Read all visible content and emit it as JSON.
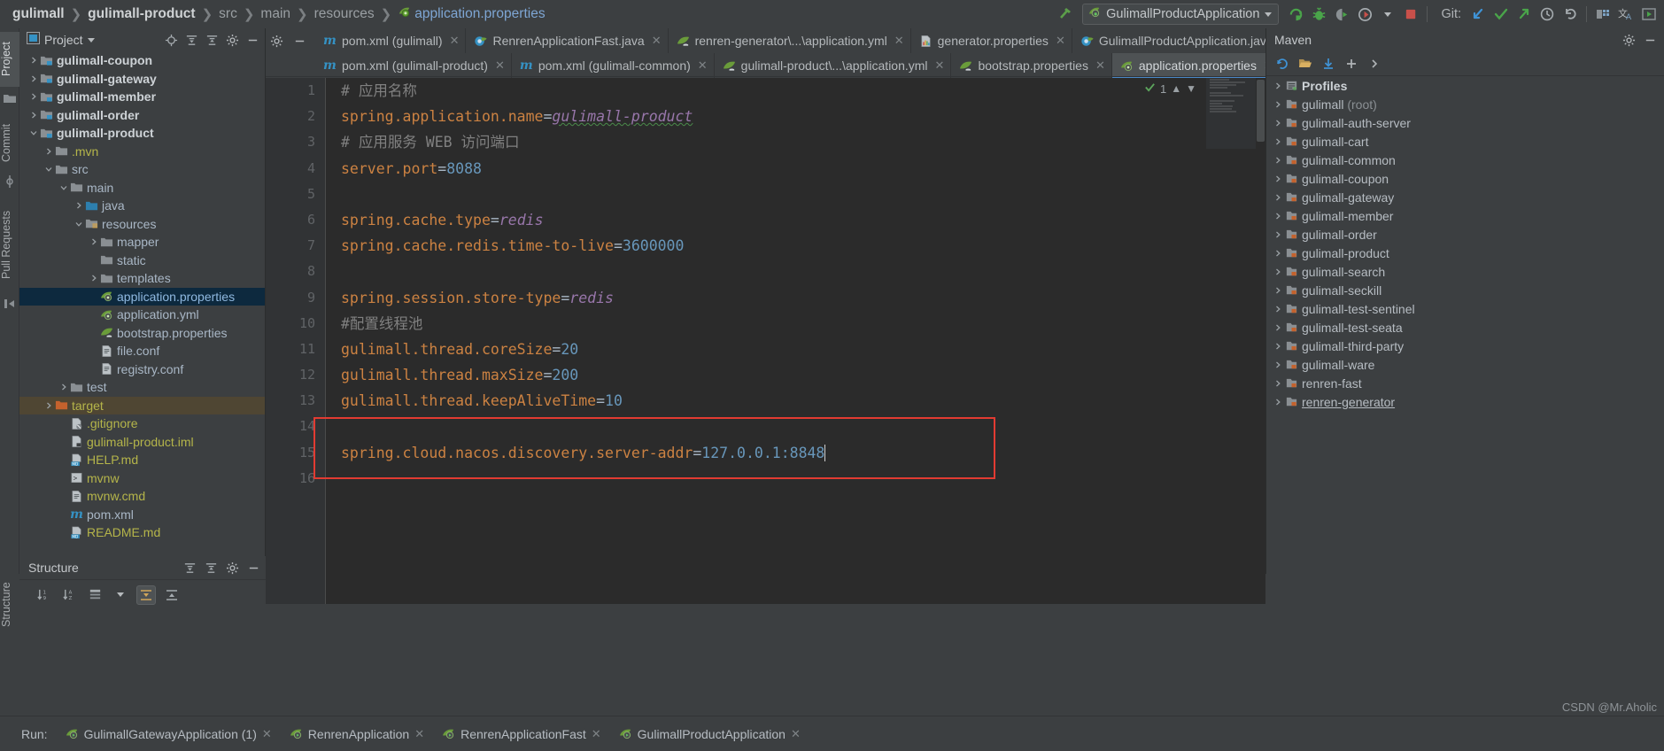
{
  "breadcrumb": {
    "items": [
      {
        "label": "gulimall",
        "style": "bold"
      },
      {
        "label": "gulimall-product",
        "style": "bold"
      },
      {
        "label": "src",
        "style": "dim"
      },
      {
        "label": "main",
        "style": "dim"
      },
      {
        "label": "resources",
        "style": "dim"
      },
      {
        "label": "application.properties",
        "style": "file",
        "icon": "properties-file-icon"
      }
    ]
  },
  "toolbar": {
    "build_icon": "hammer-icon",
    "run_configuration": "GulimallProductApplication",
    "run_config_icon": "spring-boot-icon",
    "dropdown_icon": "chevron-down-icon",
    "buttons": [
      {
        "name": "run-button",
        "icon": "run-icon"
      },
      {
        "name": "debug-button",
        "icon": "debug-bug-icon"
      },
      {
        "name": "run-with-coverage-button",
        "icon": "coverage-icon"
      },
      {
        "name": "profile-button",
        "icon": "profiler-icon"
      },
      {
        "name": "stop-button",
        "icon": "stop-square-icon"
      }
    ],
    "git_label": "Git:",
    "git_buttons": [
      {
        "name": "update-project-button",
        "icon": "arrow-down-left-icon"
      },
      {
        "name": "commit-button",
        "icon": "checkmark-icon"
      },
      {
        "name": "push-button",
        "icon": "arrow-up-right-icon"
      },
      {
        "name": "history-button",
        "icon": "clock-icon"
      },
      {
        "name": "rollback-button",
        "icon": "undo-icon"
      }
    ],
    "right_buttons": [
      {
        "name": "search-everywhere-button",
        "icon": "structure-icon"
      },
      {
        "name": "translate-button",
        "icon": "translate-icon"
      },
      {
        "name": "preview-button",
        "icon": "play-box-icon"
      }
    ]
  },
  "left_strip": {
    "items": [
      {
        "label": "Project",
        "selected": true
      },
      {
        "label": "Commit",
        "selected": false
      },
      {
        "label": "Pull Requests",
        "selected": false
      }
    ],
    "bottom_items": [
      {
        "label": "Structure",
        "selected": false
      }
    ]
  },
  "project_panel": {
    "title": "Project",
    "title_icon": "project-view-icon",
    "dropdown_icon": "chevron-down-icon",
    "header_buttons": [
      {
        "name": "locate-file-button",
        "icon": "crosshair-icon"
      },
      {
        "name": "expand-all-button",
        "icon": "expand-all-icon"
      },
      {
        "name": "collapse-all-button",
        "icon": "collapse-all-icon"
      },
      {
        "name": "settings-button",
        "icon": "gear-icon"
      },
      {
        "name": "hide-button",
        "icon": "minus-icon"
      }
    ],
    "tree": [
      {
        "label": "gulimall-coupon",
        "indent": 1,
        "twisty": "right",
        "icon": "module-icon",
        "kind": "module"
      },
      {
        "label": "gulimall-gateway",
        "indent": 1,
        "twisty": "right",
        "icon": "module-icon",
        "kind": "module"
      },
      {
        "label": "gulimall-member",
        "indent": 1,
        "twisty": "right",
        "icon": "module-icon",
        "kind": "module"
      },
      {
        "label": "gulimall-order",
        "indent": 1,
        "twisty": "right",
        "icon": "module-icon",
        "kind": "module"
      },
      {
        "label": "gulimall-product",
        "indent": 1,
        "twisty": "down",
        "icon": "module-icon",
        "kind": "module"
      },
      {
        "label": ".mvn",
        "indent": 2,
        "twisty": "right",
        "icon": "folder-icon",
        "kind": "excluded"
      },
      {
        "label": "src",
        "indent": 2,
        "twisty": "down",
        "icon": "folder-icon",
        "kind": "folder"
      },
      {
        "label": "main",
        "indent": 3,
        "twisty": "down",
        "icon": "folder-icon",
        "kind": "folder"
      },
      {
        "label": "java",
        "indent": 4,
        "twisty": "right",
        "icon": "source-root-icon",
        "kind": "folder"
      },
      {
        "label": "resources",
        "indent": 4,
        "twisty": "down",
        "icon": "resource-root-icon",
        "kind": "folder"
      },
      {
        "label": "mapper",
        "indent": 5,
        "twisty": "right",
        "icon": "folder-icon",
        "kind": "folder"
      },
      {
        "label": "static",
        "indent": 5,
        "twisty": "none",
        "icon": "folder-icon",
        "kind": "folder"
      },
      {
        "label": "templates",
        "indent": 5,
        "twisty": "right",
        "icon": "folder-icon",
        "kind": "folder"
      },
      {
        "label": "application.properties",
        "indent": 5,
        "twisty": "none",
        "icon": "spring-properties-icon",
        "kind": "file",
        "selected": true
      },
      {
        "label": "application.yml",
        "indent": 5,
        "twisty": "none",
        "icon": "spring-properties-icon",
        "kind": "file"
      },
      {
        "label": "bootstrap.properties",
        "indent": 5,
        "twisty": "none",
        "icon": "spring-leaf-icon",
        "kind": "file"
      },
      {
        "label": "file.conf",
        "indent": 5,
        "twisty": "none",
        "icon": "conf-file-icon",
        "kind": "file"
      },
      {
        "label": "registry.conf",
        "indent": 5,
        "twisty": "none",
        "icon": "conf-file-icon",
        "kind": "file"
      },
      {
        "label": "test",
        "indent": 3,
        "twisty": "right",
        "icon": "folder-icon",
        "kind": "folder"
      },
      {
        "label": "target",
        "indent": 2,
        "twisty": "right",
        "icon": "excluded-folder-icon",
        "kind": "excluded",
        "highlighted": true
      },
      {
        "label": ".gitignore",
        "indent": 3,
        "twisty": "none",
        "icon": "gitignore-icon",
        "kind": "excluded"
      },
      {
        "label": "gulimall-product.iml",
        "indent": 3,
        "twisty": "none",
        "icon": "iml-file-icon",
        "kind": "excluded"
      },
      {
        "label": "HELP.md",
        "indent": 3,
        "twisty": "none",
        "icon": "markdown-icon",
        "kind": "excluded"
      },
      {
        "label": "mvnw",
        "indent": 3,
        "twisty": "none",
        "icon": "script-icon",
        "kind": "excluded"
      },
      {
        "label": "mvnw.cmd",
        "indent": 3,
        "twisty": "none",
        "icon": "conf-file-icon",
        "kind": "excluded"
      },
      {
        "label": "pom.xml",
        "indent": 3,
        "twisty": "none",
        "icon": "maven-m-icon",
        "kind": "file"
      },
      {
        "label": "README.md",
        "indent": 3,
        "twisty": "none",
        "icon": "markdown-icon",
        "kind": "excluded"
      }
    ]
  },
  "editor_tabs": {
    "gear_icon": "gear-icon",
    "hide_icon": "minus-icon",
    "row1": [
      {
        "label": "pom.xml (gulimall)",
        "icon": "maven-m-icon",
        "active": false
      },
      {
        "label": "RenrenApplicationFast.java",
        "icon": "spring-class-icon",
        "active": false
      },
      {
        "label": "renren-generator\\...\\application.yml",
        "icon": "spring-leaf-icon",
        "active": false
      },
      {
        "label": "generator.properties",
        "icon": "properties-color-icon",
        "active": false
      },
      {
        "label": "GulimallProductApplication.java",
        "icon": "spring-class-icon",
        "active": false
      }
    ],
    "row2": [
      {
        "label": "pom.xml (gulimall-product)",
        "icon": "maven-m-icon",
        "active": false
      },
      {
        "label": "pom.xml (gulimall-common)",
        "icon": "maven-m-icon",
        "active": false
      },
      {
        "label": "gulimall-product\\...\\application.yml",
        "icon": "spring-leaf-icon",
        "active": false
      },
      {
        "label": "bootstrap.properties",
        "icon": "spring-leaf-icon",
        "active": false
      },
      {
        "label": "application.properties",
        "icon": "spring-properties-icon",
        "active": true
      }
    ]
  },
  "editor": {
    "inspection_count": "1",
    "inspection_icon": "checkmark-green-icon",
    "up_icon": "chevron-up-icon",
    "down_icon": "chevron-down-icon",
    "highlight_box_color": "#e23b32",
    "lines": [
      {
        "n": "1",
        "tokens": [
          {
            "t": "# 应用名称",
            "c": "cm"
          }
        ]
      },
      {
        "n": "2",
        "tokens": [
          {
            "t": "spring.application.name",
            "c": "k"
          },
          {
            "t": "=",
            "c": "eq"
          },
          {
            "t": "gulimall-product",
            "c": "str-underline"
          }
        ]
      },
      {
        "n": "3",
        "tokens": [
          {
            "t": "# 应用服务 WEB 访问端口",
            "c": "cm"
          }
        ]
      },
      {
        "n": "4",
        "tokens": [
          {
            "t": "server.port",
            "c": "k"
          },
          {
            "t": "=",
            "c": "eq"
          },
          {
            "t": "8088",
            "c": "num"
          }
        ]
      },
      {
        "n": "5",
        "tokens": []
      },
      {
        "n": "6",
        "tokens": [
          {
            "t": "spring.cache.type",
            "c": "k"
          },
          {
            "t": "=",
            "c": "eq"
          },
          {
            "t": "redis",
            "c": "str"
          }
        ]
      },
      {
        "n": "7",
        "tokens": [
          {
            "t": "spring.cache.redis.time-to-live",
            "c": "k"
          },
          {
            "t": "=",
            "c": "eq"
          },
          {
            "t": "3600000",
            "c": "num"
          }
        ]
      },
      {
        "n": "8",
        "tokens": []
      },
      {
        "n": "9",
        "tokens": [
          {
            "t": "spring.session.store-type",
            "c": "k"
          },
          {
            "t": "=",
            "c": "eq"
          },
          {
            "t": "redis",
            "c": "str"
          }
        ]
      },
      {
        "n": "10",
        "tokens": [
          {
            "t": "#配置线程池",
            "c": "cm"
          }
        ]
      },
      {
        "n": "11",
        "tokens": [
          {
            "t": "gulimall.thread.coreSize",
            "c": "k"
          },
          {
            "t": "=",
            "c": "eq"
          },
          {
            "t": "20",
            "c": "num"
          }
        ]
      },
      {
        "n": "12",
        "tokens": [
          {
            "t": "gulimall.thread.maxSize",
            "c": "k"
          },
          {
            "t": "=",
            "c": "eq"
          },
          {
            "t": "200",
            "c": "num"
          }
        ]
      },
      {
        "n": "13",
        "tokens": [
          {
            "t": "gulimall.thread.keepAliveTime",
            "c": "k"
          },
          {
            "t": "=",
            "c": "eq"
          },
          {
            "t": "10",
            "c": "num"
          }
        ]
      },
      {
        "n": "14",
        "tokens": []
      },
      {
        "n": "15",
        "tokens": [
          {
            "t": "spring.cloud.nacos.discovery.server-addr",
            "c": "k"
          },
          {
            "t": "=",
            "c": "eq"
          },
          {
            "t": "127.0.0.1:8848",
            "c": "num"
          }
        ],
        "caret": true
      },
      {
        "n": "16",
        "tokens": []
      }
    ]
  },
  "maven_panel": {
    "title": "Maven",
    "title_icon": "maven-icon",
    "header_buttons": [
      {
        "name": "maven-settings-button",
        "icon": "gear-icon"
      },
      {
        "name": "maven-hide-button",
        "icon": "minus-icon"
      }
    ],
    "toolbar_buttons": [
      {
        "name": "reload-all-maven-projects-button",
        "icon": "refresh-icon"
      },
      {
        "name": "add-maven-project-button",
        "icon": "folder-open-icon"
      },
      {
        "name": "download-sources-button",
        "icon": "download-icon"
      },
      {
        "name": "generate-sources-button",
        "icon": "plus-icon"
      },
      {
        "name": "more-button",
        "icon": "chevron-right-icon"
      }
    ],
    "tree": [
      {
        "label": "Profiles",
        "icon": "profiles-icon",
        "twisty": "right",
        "kind": "profiles"
      },
      {
        "label": "gulimall",
        "suffix": " (root)",
        "icon": "maven-module-icon",
        "twisty": "right"
      },
      {
        "label": "gulimall-auth-server",
        "icon": "maven-module-icon",
        "twisty": "right"
      },
      {
        "label": "gulimall-cart",
        "icon": "maven-module-icon",
        "twisty": "right"
      },
      {
        "label": "gulimall-common",
        "icon": "maven-module-icon",
        "twisty": "right"
      },
      {
        "label": "gulimall-coupon",
        "icon": "maven-module-icon",
        "twisty": "right"
      },
      {
        "label": "gulimall-gateway",
        "icon": "maven-module-icon",
        "twisty": "right"
      },
      {
        "label": "gulimall-member",
        "icon": "maven-module-icon",
        "twisty": "right"
      },
      {
        "label": "gulimall-order",
        "icon": "maven-module-icon",
        "twisty": "right"
      },
      {
        "label": "gulimall-product",
        "icon": "maven-module-icon",
        "twisty": "right"
      },
      {
        "label": "gulimall-search",
        "icon": "maven-module-icon",
        "twisty": "right"
      },
      {
        "label": "gulimall-seckill",
        "icon": "maven-module-icon",
        "twisty": "right"
      },
      {
        "label": "gulimall-test-sentinel",
        "icon": "maven-module-icon",
        "twisty": "right"
      },
      {
        "label": "gulimall-test-seata",
        "icon": "maven-module-icon",
        "twisty": "right"
      },
      {
        "label": "gulimall-third-party",
        "icon": "maven-module-icon",
        "twisty": "right"
      },
      {
        "label": "gulimall-ware",
        "icon": "maven-module-icon",
        "twisty": "right"
      },
      {
        "label": "renren-fast",
        "icon": "maven-module-icon",
        "twisty": "right"
      },
      {
        "label": "renren-generator",
        "icon": "maven-module-icon",
        "twisty": "right",
        "underlined": true
      }
    ]
  },
  "structure_panel": {
    "title": "Structure",
    "header_buttons": [
      {
        "name": "expand-all-button",
        "icon": "expand-all-icon"
      },
      {
        "name": "collapse-all-button",
        "icon": "collapse-all-icon"
      },
      {
        "name": "structure-settings-button",
        "icon": "gear-icon"
      },
      {
        "name": "structure-hide-button",
        "icon": "minus-icon"
      }
    ],
    "tool_buttons": [
      {
        "name": "sort-by-type-button",
        "icon": "sort-type-icon"
      },
      {
        "name": "sort-alphabetically-button",
        "icon": "sort-alpha-icon"
      },
      {
        "name": "group-button",
        "icon": "group-icon"
      },
      {
        "name": "more-dropdown-button",
        "icon": "chevron-down-icon"
      },
      {
        "name": "expand-all-toggle",
        "icon": "expand-toggle-icon",
        "active": true
      },
      {
        "name": "collapse-all-toggle",
        "icon": "collapse-toggle-icon",
        "active": false
      }
    ]
  },
  "run_bar": {
    "label": "Run:",
    "tabs": [
      {
        "label": "GulimallGatewayApplication (1)",
        "icon": "spring-run-icon"
      },
      {
        "label": "RenrenApplication",
        "icon": "spring-run-icon"
      },
      {
        "label": "RenrenApplicationFast",
        "icon": "spring-run-icon"
      },
      {
        "label": "GulimallProductApplication",
        "icon": "spring-run-icon"
      }
    ]
  },
  "watermark": "CSDN @Mr.Aholic"
}
